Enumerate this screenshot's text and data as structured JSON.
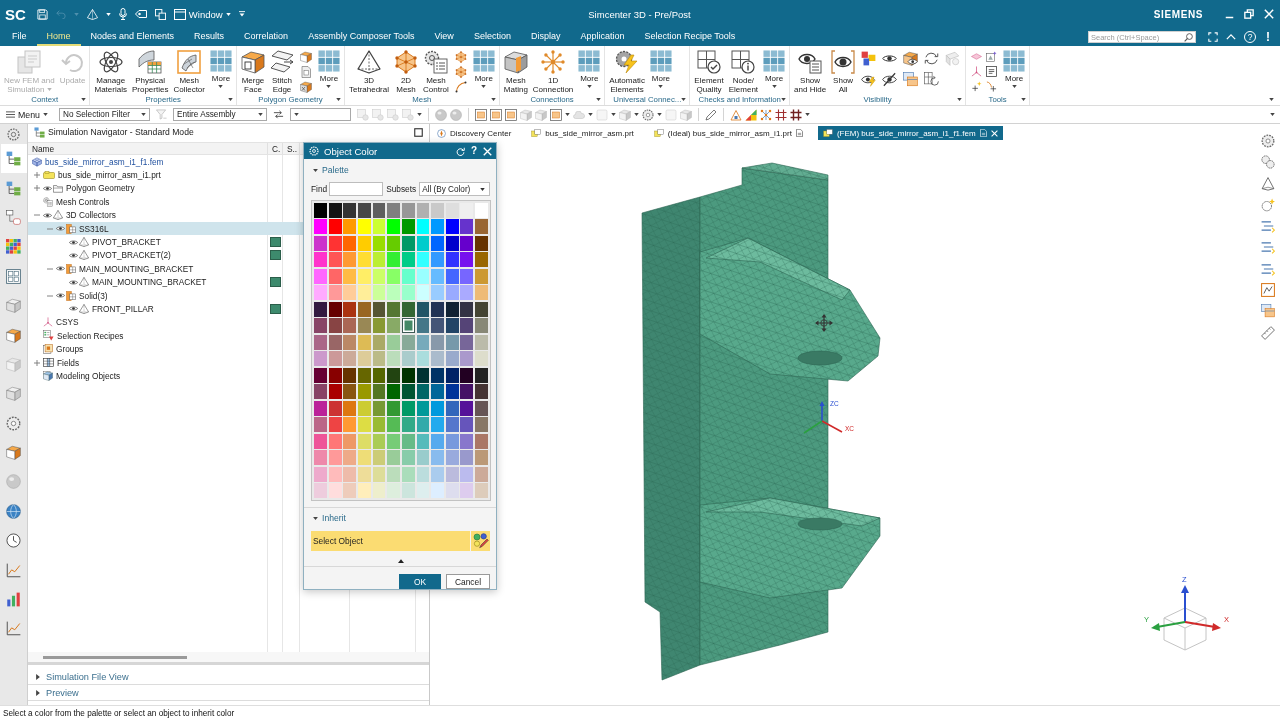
{
  "title_bar": {
    "logo": "SC",
    "window_menu": "Window",
    "title": "Simcenter 3D - Pre/Post",
    "brand": "SIEMENS"
  },
  "menu_tabs": [
    {
      "label": "File",
      "selected": false
    },
    {
      "label": "Home",
      "selected": true
    },
    {
      "label": "Nodes and Elements",
      "selected": false
    },
    {
      "label": "Results",
      "selected": false
    },
    {
      "label": "Correlation",
      "selected": false
    },
    {
      "label": "Assembly Composer Tools",
      "selected": false
    },
    {
      "label": "View",
      "selected": false
    },
    {
      "label": "Selection",
      "selected": false
    },
    {
      "label": "Display",
      "selected": false
    },
    {
      "label": "Application",
      "selected": false
    },
    {
      "label": "Selection Recipe Tools",
      "selected": false
    }
  ],
  "menu_right": {
    "search_placeholder": "Search (Ctrl+Space)",
    "help": "?",
    "notice": "!"
  },
  "ribbon": {
    "groups": [
      {
        "label": "Context",
        "items": [
          {
            "kind": "large",
            "lines": [
              "New FEM and",
              "Simulation"
            ],
            "caret": true,
            "disabled": true
          },
          {
            "kind": "large",
            "lines": [
              "Update"
            ],
            "caret": false,
            "disabled": true
          }
        ]
      },
      {
        "label": "Properties",
        "items": [
          {
            "kind": "large",
            "lines": [
              "Manage",
              "Materials"
            ],
            "caret": false,
            "disabled": false
          },
          {
            "kind": "large",
            "lines": [
              "Physical",
              "Properties"
            ],
            "caret": false,
            "disabled": false
          },
          {
            "kind": "large",
            "lines": [
              "Mesh",
              "Collector"
            ],
            "caret": false,
            "disabled": false
          },
          {
            "kind": "more",
            "lines": [
              "More"
            ],
            "disabled": false
          }
        ]
      },
      {
        "label": "Polygon Geometry",
        "items": [
          {
            "kind": "large",
            "lines": [
              "Merge",
              "Face"
            ],
            "caret": false,
            "disabled": false
          },
          {
            "kind": "large",
            "lines": [
              "Stitch",
              "Edge"
            ],
            "caret": false,
            "disabled": false
          },
          {
            "kind": "stack"
          },
          {
            "kind": "more",
            "lines": [
              "More"
            ],
            "disabled": false
          }
        ]
      },
      {
        "label": "Mesh",
        "items": [
          {
            "kind": "large",
            "lines": [
              "3D",
              "Tetrahedral"
            ],
            "caret": false,
            "disabled": false
          },
          {
            "kind": "large",
            "lines": [
              "2D",
              "Mesh"
            ],
            "caret": false,
            "disabled": false
          },
          {
            "kind": "large",
            "lines": [
              "Mesh",
              "Control"
            ],
            "caret": false,
            "disabled": false
          },
          {
            "kind": "stack"
          },
          {
            "kind": "more",
            "lines": [
              "More"
            ],
            "disabled": false
          }
        ]
      },
      {
        "label": "Connections",
        "items": [
          {
            "kind": "large",
            "lines": [
              "Mesh",
              "Mating"
            ],
            "caret": false,
            "disabled": false
          },
          {
            "kind": "large",
            "lines": [
              "1D",
              "Connection"
            ],
            "caret": false,
            "disabled": false
          },
          {
            "kind": "more",
            "lines": [
              "More"
            ],
            "disabled": false
          }
        ]
      },
      {
        "label": "Universal Connec...",
        "items": [
          {
            "kind": "large",
            "lines": [
              "Automatic",
              "Elements"
            ],
            "caret": false,
            "disabled": false
          },
          {
            "kind": "more",
            "lines": [
              "More"
            ],
            "disabled": false
          }
        ]
      },
      {
        "label": "Checks and Information",
        "items": [
          {
            "kind": "large",
            "lines": [
              "Element",
              "Quality"
            ],
            "caret": false,
            "disabled": false
          },
          {
            "kind": "large",
            "lines": [
              "Node/",
              "Element"
            ],
            "caret": false,
            "disabled": false
          },
          {
            "kind": "more",
            "lines": [
              "More"
            ],
            "disabled": false
          }
        ]
      },
      {
        "label": "Visibility",
        "items": [
          {
            "kind": "large",
            "lines": [
              "Show",
              "and Hide"
            ],
            "caret": false,
            "disabled": false
          },
          {
            "kind": "large",
            "lines": [
              "Show",
              "All"
            ],
            "caret": false,
            "disabled": false
          },
          {
            "kind": "grid"
          }
        ]
      },
      {
        "label": "Tools",
        "items": [
          {
            "kind": "grid"
          },
          {
            "kind": "more",
            "lines": [
              "More"
            ],
            "disabled": false
          }
        ]
      }
    ]
  },
  "toolbar": {
    "menu": "Menu",
    "selection_filter": "No Selection Filter",
    "scope": "Entire Assembly"
  },
  "resource_bar": {
    "tabs": [
      {
        "selected": true
      },
      {
        "selected": false
      },
      {
        "selected": false
      },
      {
        "selected": false
      },
      {
        "selected": false
      },
      {
        "selected": false
      },
      {
        "selected": false
      },
      {
        "selected": false
      },
      {
        "selected": false
      },
      {
        "selected": false
      },
      {
        "selected": false
      },
      {
        "selected": false
      },
      {
        "selected": false
      },
      {
        "selected": false
      },
      {
        "selected": false
      },
      {
        "selected": false
      },
      {
        "selected": false
      }
    ]
  },
  "navigator": {
    "title": "Simulation Navigator - Standard Mode",
    "columns": [
      "Name",
      "C.",
      "S.."
    ],
    "tree": [
      {
        "label": "bus_side_mirror_asm_i1_f1.fem",
        "kind": "fem",
        "visible": false,
        "selected": false,
        "children": [
          {
            "label": "bus_side_mirror_asm_i1.prt",
            "kind": "part",
            "expanded": false,
            "visible": false,
            "selected": false
          },
          {
            "label": "Polygon Geometry",
            "kind": "folder",
            "expanded": false,
            "visible": true,
            "selected": false
          },
          {
            "label": "Mesh Controls",
            "kind": "mesh-controls",
            "visible": false,
            "selected": false
          },
          {
            "label": "3D Collectors",
            "kind": "tetra",
            "expanded": true,
            "visible": true,
            "selected": false,
            "children": [
              {
                "label": "SS316L",
                "kind": "collector",
                "expanded": true,
                "visible": true,
                "selected": true,
                "children": [
                  {
                    "label": "PIVOT_BRACKET",
                    "kind": "tetra",
                    "visible": true,
                    "selected": false,
                    "color": "#3d8a6d"
                  },
                  {
                    "label": "PIVOT_BRACKET(2)",
                    "kind": "tetra",
                    "visible": true,
                    "selected": false,
                    "color": "#3d8a6d"
                  }
                ]
              },
              {
                "label": "MAIN_MOUNTING_BRACKET",
                "kind": "collector",
                "expanded": true,
                "visible": true,
                "selected": false,
                "children": [
                  {
                    "label": "MAIN_MOUNTING_BRACKET",
                    "kind": "tetra",
                    "visible": true,
                    "selected": false,
                    "color": "#3d8a6d"
                  }
                ]
              },
              {
                "label": "Solid(3)",
                "kind": "collector",
                "expanded": true,
                "visible": true,
                "selected": false,
                "children": [
                  {
                    "label": "FRONT_PILLAR",
                    "kind": "tetra",
                    "visible": true,
                    "selected": false,
                    "color": "#3d8a6d"
                  }
                ]
              }
            ]
          },
          {
            "label": "CSYS",
            "kind": "csys",
            "visible": false,
            "selected": false
          },
          {
            "label": "Selection Recipes",
            "kind": "recipes",
            "visible": false,
            "selected": false
          },
          {
            "label": "Groups",
            "kind": "groups",
            "visible": false,
            "selected": false
          },
          {
            "label": "Fields",
            "kind": "fields",
            "expanded": false,
            "visible": false,
            "selected": false
          },
          {
            "label": "Modeling Objects",
            "kind": "modeling",
            "visible": false,
            "selected": false
          }
        ]
      }
    ],
    "sections": [
      {
        "label": "Simulation File View",
        "expanded": false
      },
      {
        "label": "Preview",
        "expanded": false
      }
    ]
  },
  "graphics_tabs": [
    {
      "label": "Discovery Center",
      "selected": false,
      "modified": false
    },
    {
      "label": "bus_side_mirror_asm.prt",
      "selected": false,
      "modified": false
    },
    {
      "label": "(Ideal) bus_side_mirror_asm_i1.prt",
      "selected": false,
      "modified": true
    },
    {
      "label": "(FEM) bus_side_mirror_asm_i1_f1.fem",
      "selected": true,
      "modified": true
    }
  ],
  "viewport": {
    "wcs": {
      "z": "ZC",
      "x": "XC"
    },
    "view_triad": {
      "z": "Z",
      "y": "Y",
      "x": "X"
    }
  },
  "dialog": {
    "title": "Object Color",
    "help": "?",
    "palette": {
      "label": "Palette",
      "expanded": true,
      "find_label": "Find",
      "subsets_label": "Subsets",
      "subsets_value": "All (By Color)",
      "swatches": [
        [
          {
            "color": "#000000",
            "selected": false
          },
          {
            "color": "#141414",
            "selected": false
          },
          {
            "color": "#333333",
            "selected": false
          },
          {
            "color": "#474747",
            "selected": false
          },
          {
            "color": "#5e5e5e",
            "selected": false
          },
          {
            "color": "#7f7f7f",
            "selected": false
          },
          {
            "color": "#979797",
            "selected": false
          },
          {
            "color": "#b0b0b0",
            "selected": false
          },
          {
            "color": "#c9c9c9",
            "selected": false
          },
          {
            "color": "#dedede",
            "selected": false
          },
          {
            "color": "#efefef",
            "selected": false
          },
          {
            "color": "#ffffff",
            "selected": false
          }
        ],
        [
          {
            "color": "#ff00ff",
            "selected": false
          },
          {
            "color": "#ff0000",
            "selected": false
          },
          {
            "color": "#ff9900",
            "selected": false
          },
          {
            "color": "#ffff00",
            "selected": false
          },
          {
            "color": "#ccff33",
            "selected": false
          },
          {
            "color": "#00ff00",
            "selected": false
          },
          {
            "color": "#009900",
            "selected": false
          },
          {
            "color": "#00ffff",
            "selected": false
          },
          {
            "color": "#0099ff",
            "selected": false
          },
          {
            "color": "#0000ff",
            "selected": false
          },
          {
            "color": "#6633cc",
            "selected": false
          },
          {
            "color": "#996633",
            "selected": false
          }
        ],
        [
          {
            "color": "#cc33cc",
            "selected": false
          },
          {
            "color": "#ff3333",
            "selected": false
          },
          {
            "color": "#ff6600",
            "selected": false
          },
          {
            "color": "#ffcc00",
            "selected": false
          },
          {
            "color": "#99dd00",
            "selected": false
          },
          {
            "color": "#66cc00",
            "selected": false
          },
          {
            "color": "#009966",
            "selected": false
          },
          {
            "color": "#00cccc",
            "selected": false
          },
          {
            "color": "#0066ff",
            "selected": false
          },
          {
            "color": "#0000cc",
            "selected": false
          },
          {
            "color": "#6600cc",
            "selected": false
          },
          {
            "color": "#663300",
            "selected": false
          }
        ],
        [
          {
            "color": "#ff33cc",
            "selected": false
          },
          {
            "color": "#ff5555",
            "selected": false
          },
          {
            "color": "#ff9933",
            "selected": false
          },
          {
            "color": "#ffdd33",
            "selected": false
          },
          {
            "color": "#bbee33",
            "selected": false
          },
          {
            "color": "#33ee33",
            "selected": false
          },
          {
            "color": "#00cc88",
            "selected": false
          },
          {
            "color": "#33ffff",
            "selected": false
          },
          {
            "color": "#3399ff",
            "selected": false
          },
          {
            "color": "#3333ff",
            "selected": false
          },
          {
            "color": "#7711ee",
            "selected": false
          },
          {
            "color": "#996600",
            "selected": false
          }
        ],
        [
          {
            "color": "#ff66ff",
            "selected": false
          },
          {
            "color": "#ff6666",
            "selected": false
          },
          {
            "color": "#ffbb44",
            "selected": false
          },
          {
            "color": "#ffee66",
            "selected": false
          },
          {
            "color": "#ccff66",
            "selected": false
          },
          {
            "color": "#88ff66",
            "selected": false
          },
          {
            "color": "#66ffcc",
            "selected": false
          },
          {
            "color": "#99ffff",
            "selected": false
          },
          {
            "color": "#66bbff",
            "selected": false
          },
          {
            "color": "#4466ff",
            "selected": false
          },
          {
            "color": "#7766ff",
            "selected": false
          },
          {
            "color": "#cc9933",
            "selected": false
          }
        ],
        [
          {
            "color": "#ffaaff",
            "selected": false
          },
          {
            "color": "#ff9999",
            "selected": false
          },
          {
            "color": "#ffcc99",
            "selected": false
          },
          {
            "color": "#ffee99",
            "selected": false
          },
          {
            "color": "#ccff99",
            "selected": false
          },
          {
            "color": "#bbffbb",
            "selected": false
          },
          {
            "color": "#99ffcc",
            "selected": false
          },
          {
            "color": "#ccffff",
            "selected": false
          },
          {
            "color": "#99ccff",
            "selected": false
          },
          {
            "color": "#99aaff",
            "selected": false
          },
          {
            "color": "#aaaaff",
            "selected": false
          },
          {
            "color": "#eebb77",
            "selected": false
          }
        ],
        [
          {
            "color": "#331a40",
            "selected": false
          },
          {
            "color": "#660000",
            "selected": false
          },
          {
            "color": "#aa3311",
            "selected": false
          },
          {
            "color": "#996622",
            "selected": false
          },
          {
            "color": "#555533",
            "selected": false
          },
          {
            "color": "#557733",
            "selected": false
          },
          {
            "color": "#336633",
            "selected": false
          },
          {
            "color": "#225566",
            "selected": false
          },
          {
            "color": "#223355",
            "selected": false
          },
          {
            "color": "#112233",
            "selected": false
          },
          {
            "color": "#333344",
            "selected": false
          },
          {
            "color": "#444433",
            "selected": false
          }
        ],
        [
          {
            "color": "#884466",
            "selected": false
          },
          {
            "color": "#884444",
            "selected": false
          },
          {
            "color": "#aa6655",
            "selected": false
          },
          {
            "color": "#998855",
            "selected": false
          },
          {
            "color": "#889933",
            "selected": false
          },
          {
            "color": "#88aa66",
            "selected": false
          },
          {
            "color": "#448866",
            "selected": true
          },
          {
            "color": "#447788",
            "selected": false
          },
          {
            "color": "#445577",
            "selected": false
          },
          {
            "color": "#224466",
            "selected": false
          },
          {
            "color": "#554477",
            "selected": false
          },
          {
            "color": "#888877",
            "selected": false
          }
        ],
        [
          {
            "color": "#aa6688",
            "selected": false
          },
          {
            "color": "#996666",
            "selected": false
          },
          {
            "color": "#bb8866",
            "selected": false
          },
          {
            "color": "#ddbb55",
            "selected": false
          },
          {
            "color": "#aaaa66",
            "selected": false
          },
          {
            "color": "#99cc99",
            "selected": false
          },
          {
            "color": "#88aa99",
            "selected": false
          },
          {
            "color": "#77aabb",
            "selected": false
          },
          {
            "color": "#8899aa",
            "selected": false
          },
          {
            "color": "#7799aa",
            "selected": false
          },
          {
            "color": "#776699",
            "selected": false
          },
          {
            "color": "#bbbbaa",
            "selected": false
          }
        ],
        [
          {
            "color": "#cc99cc",
            "selected": false
          },
          {
            "color": "#cc9999",
            "selected": false
          },
          {
            "color": "#ccaa99",
            "selected": false
          },
          {
            "color": "#ddcc99",
            "selected": false
          },
          {
            "color": "#bbbb88",
            "selected": false
          },
          {
            "color": "#bbddbb",
            "selected": false
          },
          {
            "color": "#aacccc",
            "selected": false
          },
          {
            "color": "#aadddd",
            "selected": false
          },
          {
            "color": "#aabbcc",
            "selected": false
          },
          {
            "color": "#99aacc",
            "selected": false
          },
          {
            "color": "#aa99cc",
            "selected": false
          },
          {
            "color": "#ddddcc",
            "selected": false
          }
        ],
        [
          {
            "color": "#660033",
            "selected": false
          },
          {
            "color": "#880000",
            "selected": false
          },
          {
            "color": "#663300",
            "selected": false
          },
          {
            "color": "#666600",
            "selected": false
          },
          {
            "color": "#556600",
            "selected": false
          },
          {
            "color": "#224411",
            "selected": false
          },
          {
            "color": "#003300",
            "selected": false
          },
          {
            "color": "#003333",
            "selected": false
          },
          {
            "color": "#003366",
            "selected": false
          },
          {
            "color": "#002266",
            "selected": false
          },
          {
            "color": "#220022",
            "selected": false
          },
          {
            "color": "#222222",
            "selected": false
          }
        ],
        [
          {
            "color": "#884466",
            "selected": false
          },
          {
            "color": "#aa0000",
            "selected": false
          },
          {
            "color": "#885511",
            "selected": false
          },
          {
            "color": "#999900",
            "selected": false
          },
          {
            "color": "#557722",
            "selected": false
          },
          {
            "color": "#006600",
            "selected": false
          },
          {
            "color": "#005533",
            "selected": false
          },
          {
            "color": "#006666",
            "selected": false
          },
          {
            "color": "#006699",
            "selected": false
          },
          {
            "color": "#003399",
            "selected": false
          },
          {
            "color": "#441166",
            "selected": false
          },
          {
            "color": "#443333",
            "selected": false
          }
        ],
        [
          {
            "color": "#bb2299",
            "selected": false
          },
          {
            "color": "#cc3333",
            "selected": false
          },
          {
            "color": "#dd7711",
            "selected": false
          },
          {
            "color": "#cccc33",
            "selected": false
          },
          {
            "color": "#779933",
            "selected": false
          },
          {
            "color": "#339933",
            "selected": false
          },
          {
            "color": "#009966",
            "selected": false
          },
          {
            "color": "#009999",
            "selected": false
          },
          {
            "color": "#0099dd",
            "selected": false
          },
          {
            "color": "#3366bb",
            "selected": false
          },
          {
            "color": "#551199",
            "selected": false
          },
          {
            "color": "#665555",
            "selected": false
          }
        ],
        [
          {
            "color": "#bb6688",
            "selected": false
          },
          {
            "color": "#ee4444",
            "selected": false
          },
          {
            "color": "#ff9933",
            "selected": false
          },
          {
            "color": "#dddd44",
            "selected": false
          },
          {
            "color": "#99bb33",
            "selected": false
          },
          {
            "color": "#55bb55",
            "selected": false
          },
          {
            "color": "#33aa88",
            "selected": false
          },
          {
            "color": "#33aaaa",
            "selected": false
          },
          {
            "color": "#22aaee",
            "selected": false
          },
          {
            "color": "#5577cc",
            "selected": false
          },
          {
            "color": "#6655bb",
            "selected": false
          },
          {
            "color": "#887766",
            "selected": false
          }
        ],
        [
          {
            "color": "#ee5599",
            "selected": false
          },
          {
            "color": "#ff7777",
            "selected": false
          },
          {
            "color": "#ee9966",
            "selected": false
          },
          {
            "color": "#dddd66",
            "selected": false
          },
          {
            "color": "#aacc55",
            "selected": false
          },
          {
            "color": "#77cc77",
            "selected": false
          },
          {
            "color": "#66bb88",
            "selected": false
          },
          {
            "color": "#55bbbb",
            "selected": false
          },
          {
            "color": "#55aaee",
            "selected": false
          },
          {
            "color": "#7799dd",
            "selected": false
          },
          {
            "color": "#8877cc",
            "selected": false
          },
          {
            "color": "#aa7766",
            "selected": false
          }
        ],
        [
          {
            "color": "#ee88aa",
            "selected": false
          },
          {
            "color": "#ff9999",
            "selected": false
          },
          {
            "color": "#eeaa88",
            "selected": false
          },
          {
            "color": "#eedd77",
            "selected": false
          },
          {
            "color": "#cccc77",
            "selected": false
          },
          {
            "color": "#99cc99",
            "selected": false
          },
          {
            "color": "#88ccaa",
            "selected": false
          },
          {
            "color": "#99cccc",
            "selected": false
          },
          {
            "color": "#88bbee",
            "selected": false
          },
          {
            "color": "#99aadd",
            "selected": false
          },
          {
            "color": "#9999cc",
            "selected": false
          },
          {
            "color": "#bb9977",
            "selected": false
          }
        ],
        [
          {
            "color": "#eeaacc",
            "selected": false
          },
          {
            "color": "#ffbbbb",
            "selected": false
          },
          {
            "color": "#eebbaa",
            "selected": false
          },
          {
            "color": "#eedd99",
            "selected": false
          },
          {
            "color": "#dddd99",
            "selected": false
          },
          {
            "color": "#bbddbb",
            "selected": false
          },
          {
            "color": "#aaddbb",
            "selected": false
          },
          {
            "color": "#bbdddd",
            "selected": false
          },
          {
            "color": "#aaccee",
            "selected": false
          },
          {
            "color": "#bbbbdd",
            "selected": false
          },
          {
            "color": "#bbbbee",
            "selected": false
          },
          {
            "color": "#ccaa99",
            "selected": false
          }
        ],
        [
          {
            "color": "#eeccdd",
            "selected": false
          },
          {
            "color": "#ffdddd",
            "selected": false
          },
          {
            "color": "#eeccbb",
            "selected": false
          },
          {
            "color": "#ffeebb",
            "selected": false
          },
          {
            "color": "#eeeecc",
            "selected": false
          },
          {
            "color": "#ddeedd",
            "selected": false
          },
          {
            "color": "#cce5dd",
            "selected": false
          },
          {
            "color": "#ddeeee",
            "selected": false
          },
          {
            "color": "#ddeeff",
            "selected": false
          },
          {
            "color": "#ddddee",
            "selected": false
          },
          {
            "color": "#ddccee",
            "selected": false
          },
          {
            "color": "#ddccbb",
            "selected": false
          }
        ]
      ]
    },
    "inherit": {
      "label": "Inherit",
      "expanded": true,
      "select_label": "Select Object"
    },
    "buttons": [
      {
        "label": "OK",
        "kind": "primary"
      },
      {
        "label": "Cancel",
        "kind": "secondary"
      }
    ]
  },
  "status_bar": {
    "message": "Select a color from the palette or select an object to inherit color"
  }
}
